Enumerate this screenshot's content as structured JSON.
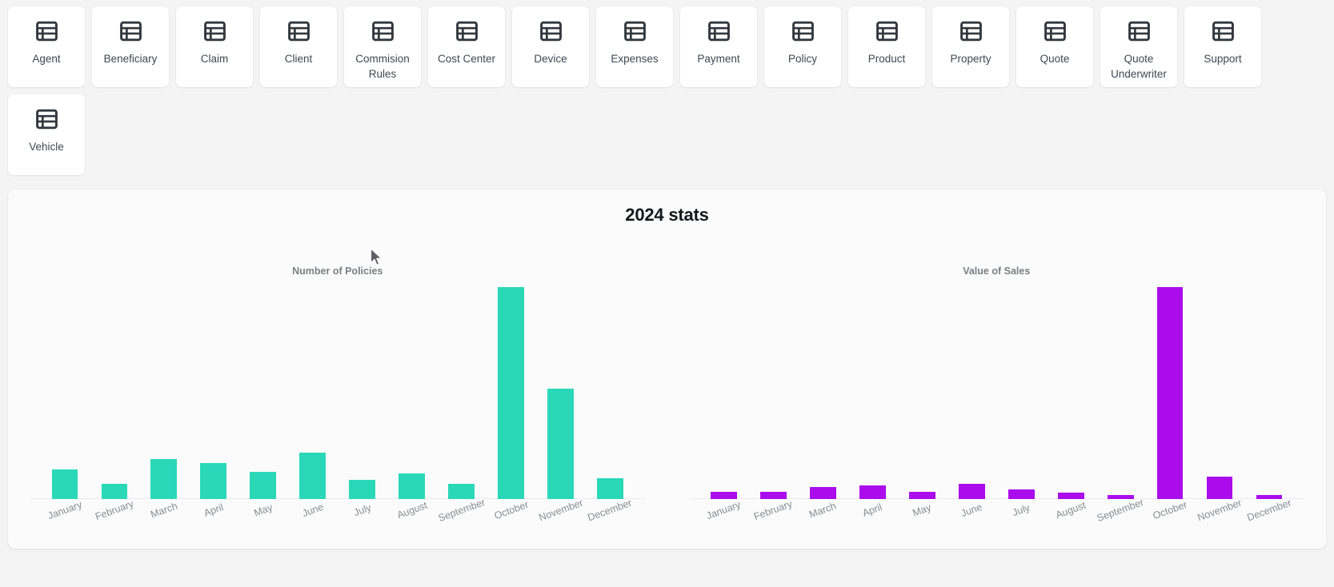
{
  "tiles": [
    {
      "label": "Agent",
      "icon": "table-icon"
    },
    {
      "label": "Beneficiary",
      "icon": "table-icon"
    },
    {
      "label": "Claim",
      "icon": "table-icon"
    },
    {
      "label": "Client",
      "icon": "table-icon"
    },
    {
      "label": "Commision Rules",
      "icon": "table-icon"
    },
    {
      "label": "Cost Center",
      "icon": "table-icon"
    },
    {
      "label": "Device",
      "icon": "table-icon"
    },
    {
      "label": "Expenses",
      "icon": "table-icon"
    },
    {
      "label": "Payment",
      "icon": "table-icon"
    },
    {
      "label": "Policy",
      "icon": "table-icon"
    },
    {
      "label": "Product",
      "icon": "table-icon"
    },
    {
      "label": "Property",
      "icon": "table-icon"
    },
    {
      "label": "Quote",
      "icon": "table-icon"
    },
    {
      "label": "Quote Underwriter",
      "icon": "table-icon"
    },
    {
      "label": "Support",
      "icon": "table-icon"
    },
    {
      "label": "Vehicle",
      "icon": "table-icon"
    }
  ],
  "stats": {
    "title": "2024 stats"
  },
  "colors": {
    "policies_bar": "#2ad8b8",
    "sales_bar": "#aa0ceb",
    "page_background": "#f4f4f4",
    "card_background": "#fbfbfb",
    "tile_background": "#ffffff",
    "label_text": "#878c93",
    "subtitle_text": "#7a7f86"
  },
  "chart_data": [
    {
      "type": "bar",
      "title": "Number of Policies",
      "xlabel": "",
      "ylabel": "",
      "grid": false,
      "legend": "none",
      "categories": [
        "January",
        "February",
        "March",
        "April",
        "May",
        "June",
        "July",
        "August",
        "September",
        "October",
        "November",
        "December"
      ],
      "values": [
        14,
        7,
        19,
        17,
        13,
        22,
        9,
        12,
        7,
        100,
        52,
        10
      ],
      "ylim": [
        0,
        100
      ]
    },
    {
      "type": "bar",
      "title": "Value of Sales",
      "xlabel": "",
      "ylabel": "",
      "grid": false,
      "legend": "none",
      "categories": [
        "January",
        "February",
        "March",
        "April",
        "May",
        "June",
        "July",
        "August",
        "September",
        "October",
        "November",
        "December"
      ],
      "values": [
        3.5,
        3.5,
        5.5,
        6.5,
        3.5,
        7.0,
        4.5,
        3.0,
        2.0,
        100,
        10.5,
        1.5
      ],
      "ylim": [
        0,
        100
      ]
    }
  ]
}
